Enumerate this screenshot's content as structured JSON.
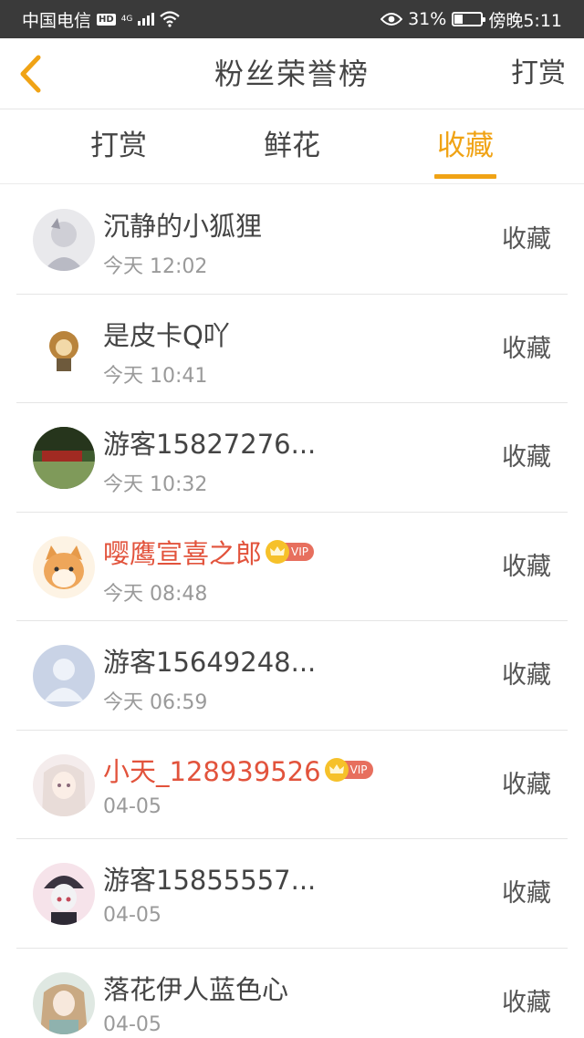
{
  "status_bar": {
    "carrier": "中国电信",
    "hd": "HD",
    "network": "4G",
    "battery_percent": "31%",
    "battery_level": 0.31,
    "time": "傍晚5:11"
  },
  "nav": {
    "title": "粉丝荣誉榜",
    "action": "打赏"
  },
  "tabs": [
    {
      "label": "打赏"
    },
    {
      "label": "鲜花"
    },
    {
      "label": "收藏"
    }
  ],
  "active_tab": "收藏",
  "colors": {
    "accent": "#f0a315",
    "vip_name": "#e2533c"
  },
  "list": [
    {
      "name": "沉静的小狐狸",
      "time": "今天 12:02",
      "action": "收藏",
      "vip": false
    },
    {
      "name": "是皮卡Q吖",
      "time": "今天 10:41",
      "action": "收藏",
      "vip": false
    },
    {
      "name": "游客15827276...",
      "time": "今天 10:32",
      "action": "收藏",
      "vip": false
    },
    {
      "name": "嘤鹰宣喜之郎",
      "time": "今天 08:48",
      "action": "收藏",
      "vip": true,
      "vip_label": "VIP"
    },
    {
      "name": "游客15649248...",
      "time": "今天 06:59",
      "action": "收藏",
      "vip": false
    },
    {
      "name": "小天_128939526",
      "time": "04-05",
      "action": "收藏",
      "vip": true,
      "vip_label": "VIP"
    },
    {
      "name": "游客15855557...",
      "time": "04-05",
      "action": "收藏",
      "vip": false
    },
    {
      "name": "落花伊人蓝色心",
      "time": "04-05",
      "action": "收藏",
      "vip": false
    }
  ]
}
